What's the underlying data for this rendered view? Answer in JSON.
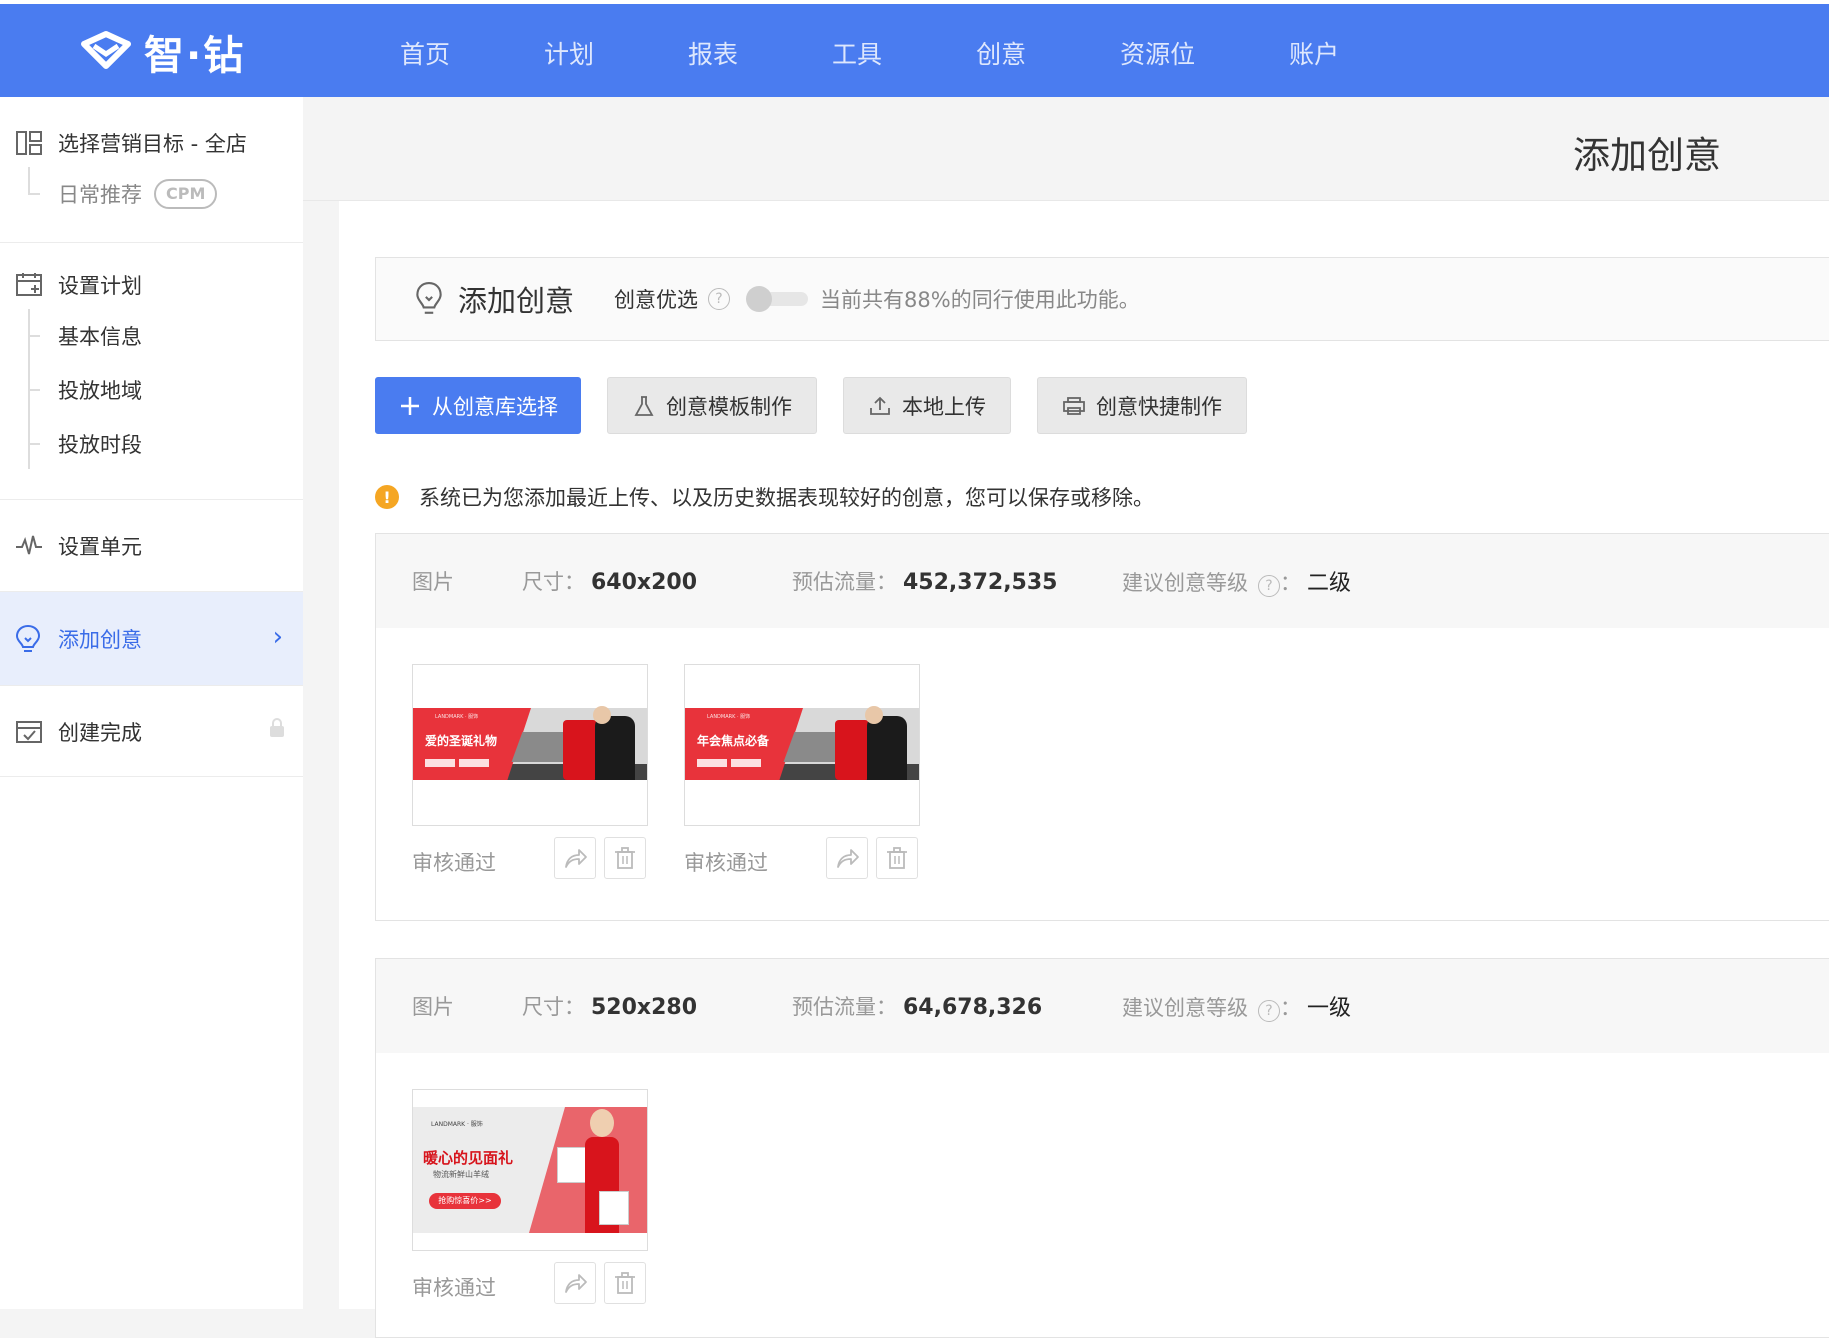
{
  "app": {
    "logo_text": "智·钻"
  },
  "nav": [
    "首页",
    "计划",
    "报表",
    "工具",
    "创意",
    "资源位",
    "账户"
  ],
  "sidebar": {
    "target": {
      "label": "选择营销目标 - 全店",
      "sub": "日常推荐",
      "badge": "CPM"
    },
    "plan": {
      "label": "设置计划",
      "items": [
        "基本信息",
        "投放地域",
        "投放时段"
      ]
    },
    "unit": {
      "label": "设置单元"
    },
    "creative": {
      "label": "添加创意"
    },
    "done": {
      "label": "创建完成"
    }
  },
  "page": {
    "title": "添加创意"
  },
  "header_panel": {
    "title": "添加创意",
    "option_label": "创意优选",
    "help": "?",
    "hint": "当前共有88%的同行使用此功能。"
  },
  "buttons": {
    "library": "从创意库选择",
    "template": "创意模板制作",
    "upload": "本地上传",
    "quick": "创意快捷制作"
  },
  "notice": "系统已为您添加最近上传、以及历史数据表现较好的创意，您可以保存或移除。",
  "groups": [
    {
      "type": "图片",
      "size_label": "尺寸：",
      "size": "640x200",
      "traffic_label": "预估流量：",
      "traffic": "452,372,535",
      "level_label": "建议创意等级",
      "level_sep": "：",
      "level": "二级",
      "cards": [
        {
          "status": "审核通过",
          "banner_small": "LANDMARK · 服饰",
          "banner_title": "爱的圣诞礼物"
        },
        {
          "status": "审核通过",
          "banner_small": "LANDMARK · 服饰",
          "banner_title": "年会焦点必备"
        }
      ]
    },
    {
      "type": "图片",
      "size_label": "尺寸：",
      "size": "520x280",
      "traffic_label": "预估流量：",
      "traffic": "64,678,326",
      "level_label": "建议创意等级",
      "level_sep": "：",
      "level": "一级",
      "cards": [
        {
          "status": "审核通过",
          "banner_small": "LANDMARK · 服饰",
          "banner_title": "暖心的见面礼",
          "banner_sub": "物流新鲜山羊绒",
          "banner_cta": "抢购惊喜价>>"
        }
      ]
    }
  ],
  "colors": {
    "brand": "#4a7cf0",
    "active_bg": "#e8eefc",
    "warning": "#f5a623"
  },
  "icons": [
    "logo-icon",
    "layout-icon",
    "calendar-icon",
    "pulse-icon",
    "bulb-icon",
    "done-icon",
    "lock-icon",
    "chevron-right-icon",
    "plus-icon",
    "flask-icon",
    "upload-icon",
    "printer-icon",
    "warning-icon",
    "share-icon",
    "trash-icon"
  ]
}
